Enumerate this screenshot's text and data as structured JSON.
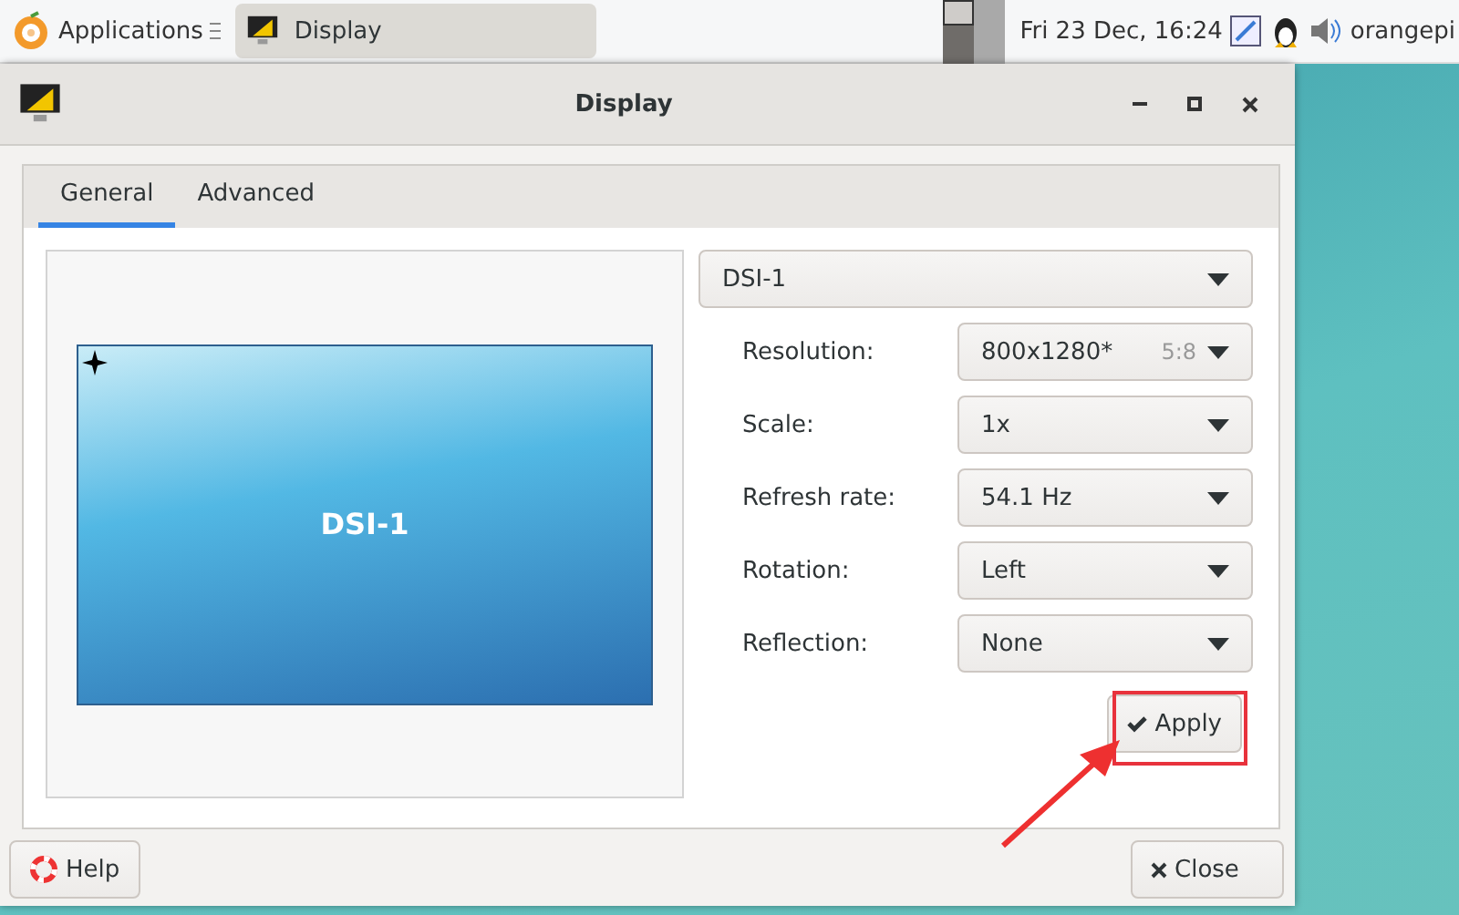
{
  "panel": {
    "apps_label": "Applications",
    "task": {
      "label": "Display",
      "selected": true
    },
    "clock": "Fri 23 Dec, 16:24",
    "user": "orangepi"
  },
  "window": {
    "title": "Display"
  },
  "tabs": [
    {
      "label": "General",
      "selected": true
    },
    {
      "label": "Advanced",
      "selected": false
    }
  ],
  "preview": {
    "monitor_label": "DSI-1"
  },
  "output_select": {
    "value": "DSI-1"
  },
  "settings": [
    {
      "label": "Resolution:",
      "value": "800x1280*",
      "hint": "5:8"
    },
    {
      "label": "Scale:",
      "value": "1x"
    },
    {
      "label": "Refresh rate:",
      "value": "54.1 Hz"
    },
    {
      "label": "Rotation:",
      "value": "Left"
    },
    {
      "label": "Reflection:",
      "value": "None"
    }
  ],
  "buttons": {
    "apply": "Apply",
    "help": "Help",
    "close": "Close"
  }
}
